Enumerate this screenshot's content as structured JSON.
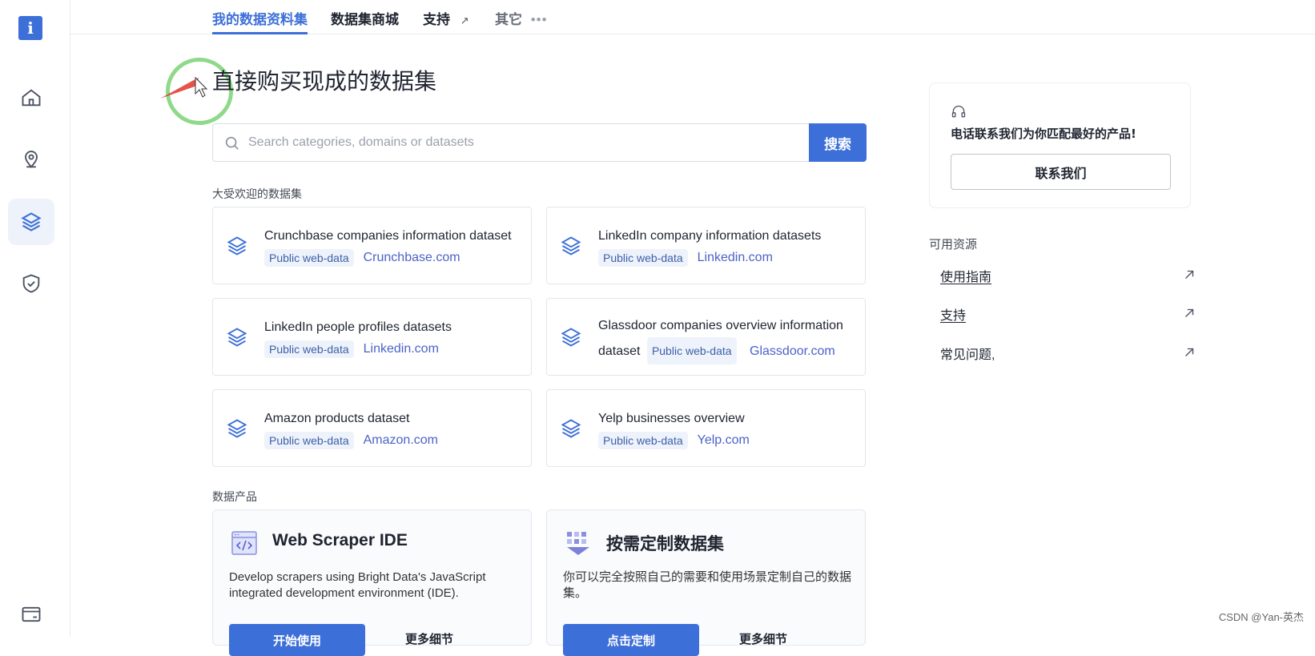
{
  "nav": {
    "tabs": [
      {
        "label": "我的数据资料集"
      },
      {
        "label": "数据集商城"
      },
      {
        "label": "支持"
      },
      {
        "label": "其它"
      }
    ]
  },
  "page": {
    "title": "直接购买现成的数据集"
  },
  "search": {
    "placeholder": "Search categories, domains or datasets",
    "button_label": "搜索"
  },
  "popular": {
    "heading": "大受欢迎的数据集",
    "cards": [
      {
        "title": "Crunchbase companies information dataset",
        "tag": "Public web-data",
        "domain": "Crunchbase.com"
      },
      {
        "title": "LinkedIn company information datasets",
        "tag": "Public web-data",
        "domain": "Linkedin.com"
      },
      {
        "title": "LinkedIn people profiles datasets",
        "tag": "Public web-data",
        "domain": "Linkedin.com"
      },
      {
        "title": "Glassdoor companies overview information dataset",
        "tag": "Public web-data",
        "domain": "Glassdoor.com"
      },
      {
        "title": "Amazon products dataset",
        "tag": "Public web-data",
        "domain": "Amazon.com"
      },
      {
        "title": "Yelp businesses overview",
        "tag": "Public web-data",
        "domain": "Yelp.com"
      }
    ]
  },
  "products": {
    "heading": "数据产品",
    "items": [
      {
        "title": "Web Scraper IDE",
        "desc": "Develop scrapers using Bright Data's JavaScript integrated development environment (IDE).",
        "button": "开始使用",
        "link": "更多细节"
      },
      {
        "title": "按需定制数据集",
        "desc": "你可以完全按照自己的需要和使用场景定制自己的数据集。",
        "button": "点击定制",
        "link": "更多细节"
      }
    ]
  },
  "contact": {
    "text": "电话联系我们为你匹配最好的产品!",
    "button": "联系我们"
  },
  "resources": {
    "heading": "可用资源",
    "links": [
      {
        "label": "使用指南"
      },
      {
        "label": "支持"
      },
      {
        "label": "常见问题,"
      }
    ]
  },
  "watermark": "CSDN @Yan-英杰",
  "colors": {
    "accent": "#3d6fd8",
    "domain_link": "#4a63c8",
    "tag_bg": "#eef3fb"
  }
}
